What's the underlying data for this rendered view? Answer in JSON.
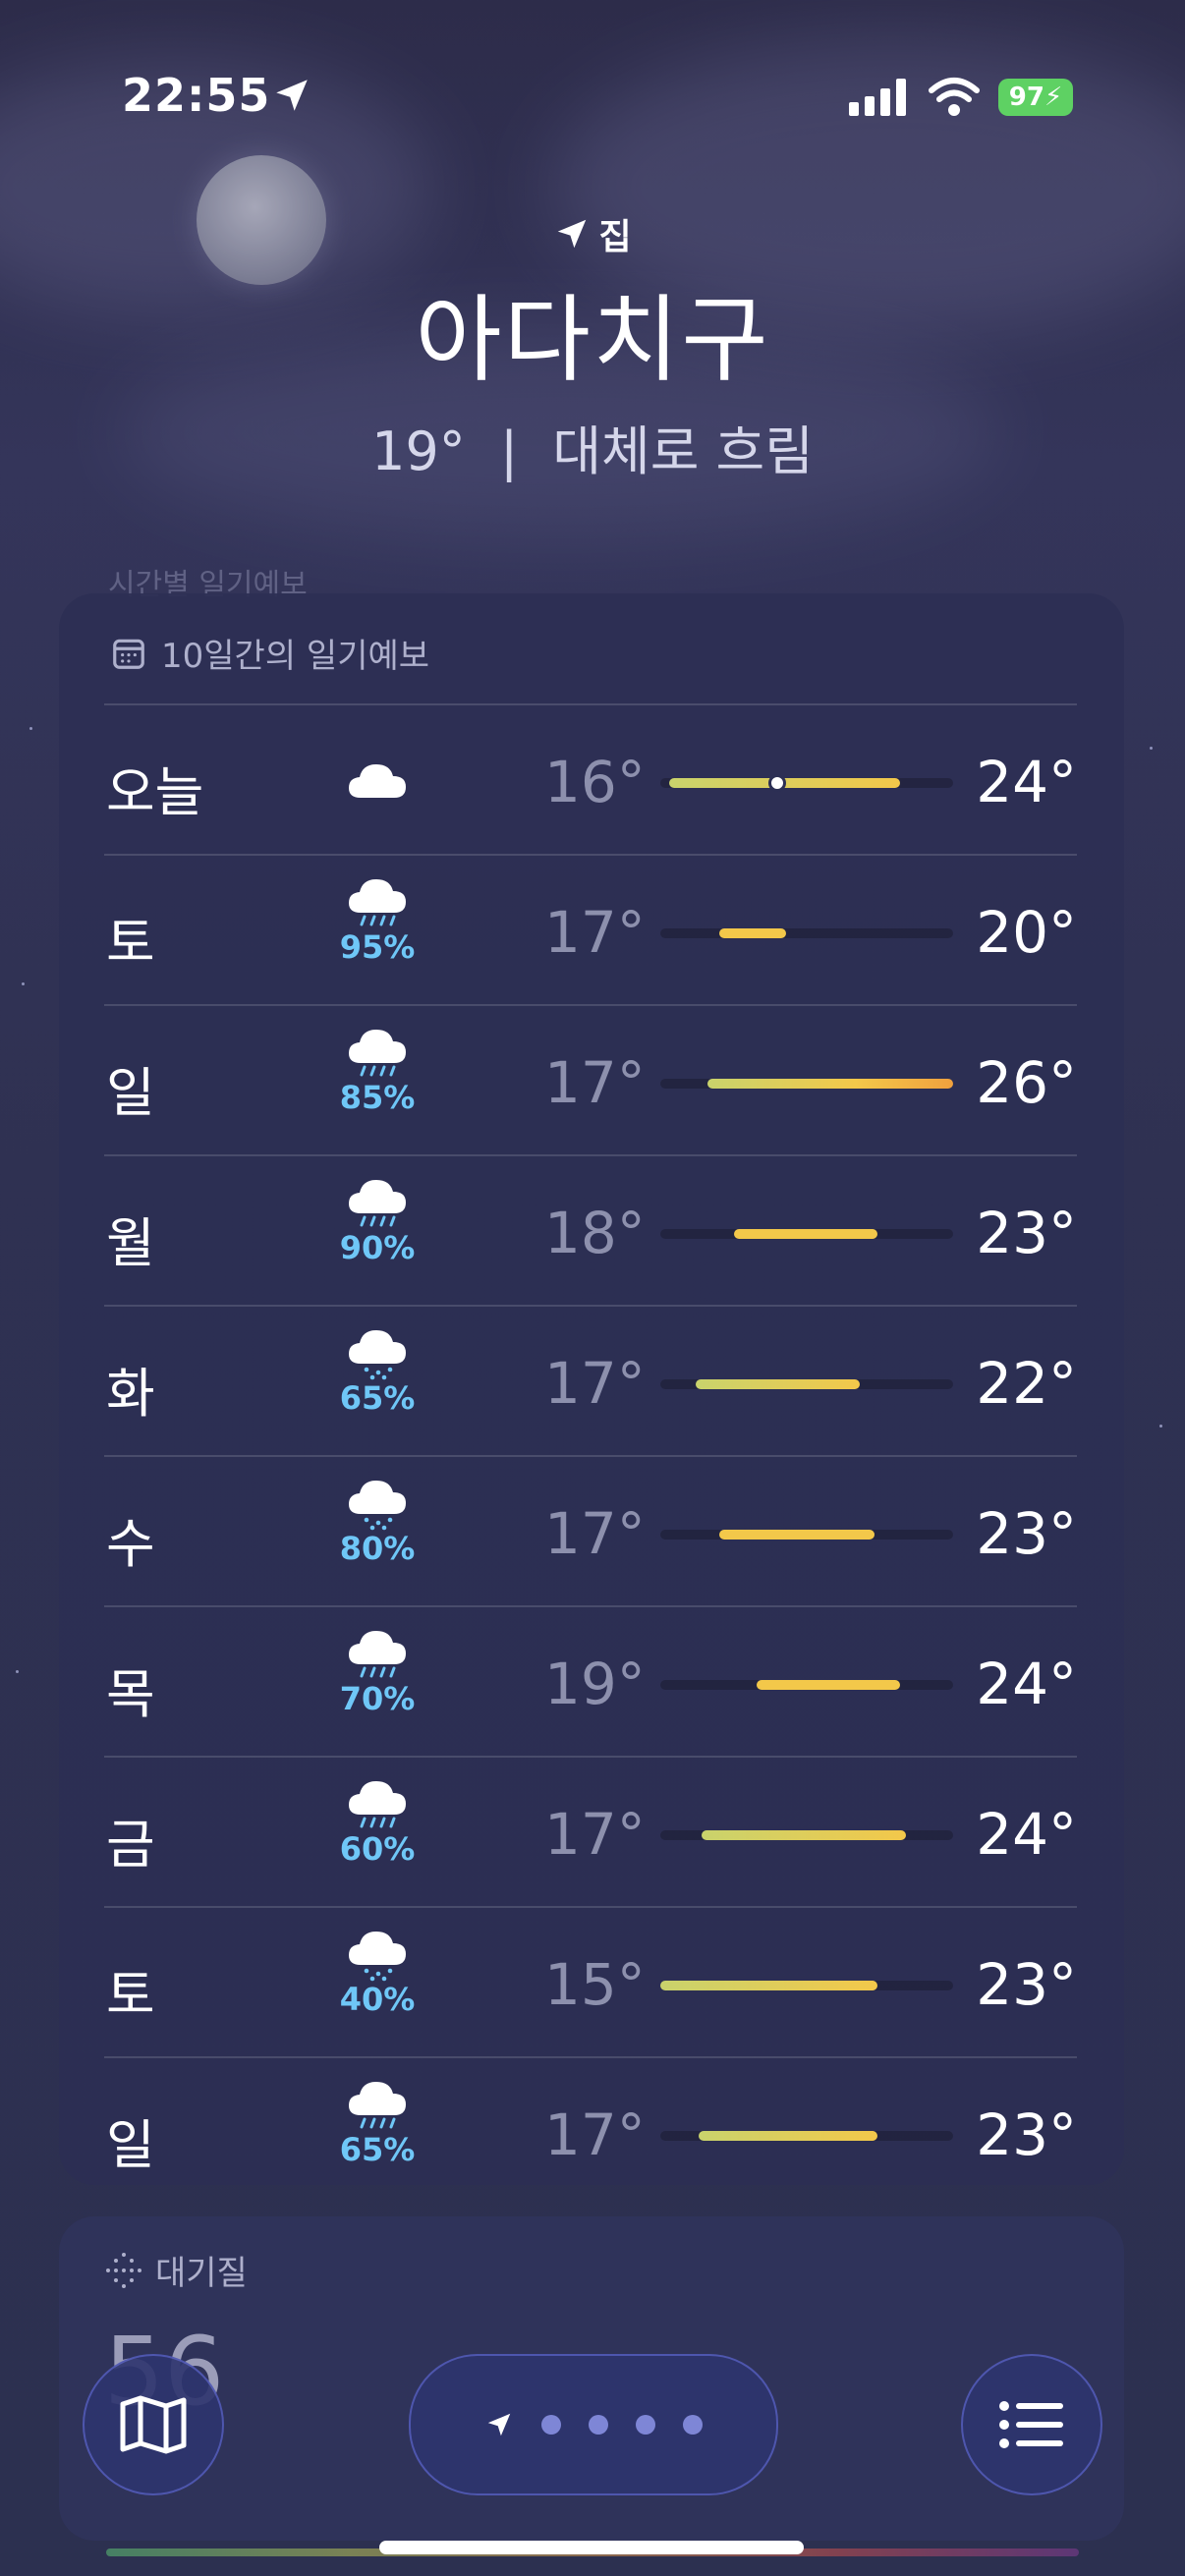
{
  "status": {
    "time": "22:55",
    "battery": "97"
  },
  "header": {
    "tag": "집",
    "city": "아다치구",
    "temp": "19°",
    "separator": "|",
    "condition": "대체로 흐림"
  },
  "hourly_ghost": "시간별 일기예보",
  "forecast": {
    "title": "10일간의 일기예보",
    "days": [
      {
        "day": "오늘",
        "icon": "cloud-icon",
        "precip": "",
        "low": "16°",
        "high": "24°",
        "bar": [
          0.03,
          0.82
        ],
        "current": 0.4
      },
      {
        "day": "토",
        "icon": "cloud-rain-icon",
        "precip": "95%",
        "low": "17°",
        "high": "20°",
        "bar": [
          0.2,
          0.43
        ]
      },
      {
        "day": "일",
        "icon": "cloud-rain-icon",
        "precip": "85%",
        "low": "17°",
        "high": "26°",
        "bar": [
          0.16,
          1.0
        ]
      },
      {
        "day": "월",
        "icon": "cloud-rain-icon",
        "precip": "90%",
        "low": "18°",
        "high": "23°",
        "bar": [
          0.25,
          0.74
        ]
      },
      {
        "day": "화",
        "icon": "cloud-drizzle-icon",
        "precip": "65%",
        "low": "17°",
        "high": "22°",
        "bar": [
          0.12,
          0.68
        ]
      },
      {
        "day": "수",
        "icon": "cloud-drizzle-icon",
        "precip": "80%",
        "low": "17°",
        "high": "23°",
        "bar": [
          0.2,
          0.73
        ]
      },
      {
        "day": "목",
        "icon": "cloud-rain-icon",
        "precip": "70%",
        "low": "19°",
        "high": "24°",
        "bar": [
          0.33,
          0.82
        ]
      },
      {
        "day": "금",
        "icon": "cloud-rain-icon",
        "precip": "60%",
        "low": "17°",
        "high": "24°",
        "bar": [
          0.14,
          0.84
        ]
      },
      {
        "day": "토",
        "icon": "cloud-drizzle-icon",
        "precip": "40%",
        "low": "15°",
        "high": "23°",
        "bar": [
          0.0,
          0.74
        ]
      },
      {
        "day": "일",
        "icon": "cloud-rain-icon",
        "precip": "65%",
        "low": "17°",
        "high": "23°",
        "bar": [
          0.13,
          0.74
        ]
      }
    ]
  },
  "air_quality": {
    "title": "대기질",
    "value": "56"
  },
  "colors": {
    "precip": "#6fc7f7",
    "bar_cool": "#c9d36c",
    "bar_warm": "#f3c84a",
    "bar_hot": "#f0a13e",
    "battery": "#5ed163"
  }
}
